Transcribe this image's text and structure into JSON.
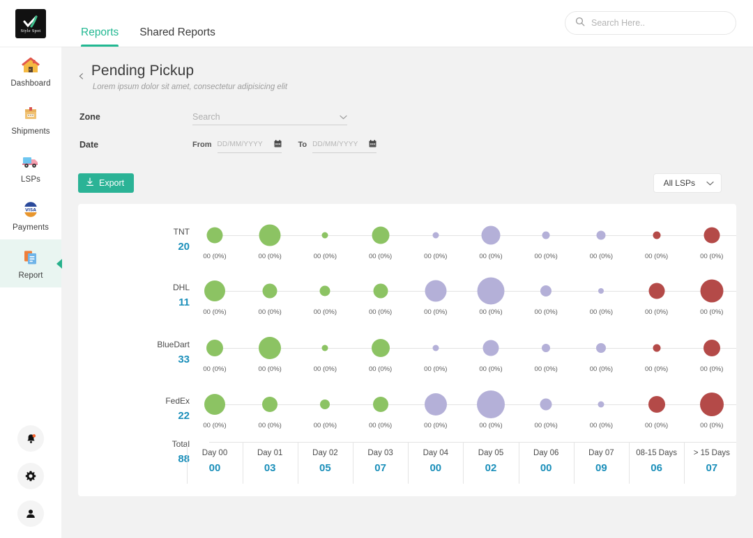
{
  "brand": {
    "name": "Style Spot",
    "logo_icon": "checkmark-logo-icon"
  },
  "sidebar": {
    "items": [
      {
        "label": "Dashboard",
        "icon": "house-icon",
        "active": false
      },
      {
        "label": "Shipments",
        "icon": "package-box-icon",
        "active": false
      },
      {
        "label": "LSPs",
        "icon": "delivery-truck-icon",
        "active": false
      },
      {
        "label": "Payments",
        "icon": "visa-card-icon",
        "active": false
      },
      {
        "label": "Report",
        "icon": "report-document-icon",
        "active": true
      }
    ],
    "bottom_icons": [
      {
        "name": "notification-bell-icon",
        "badge": true
      },
      {
        "name": "settings-gear-icon",
        "badge": false
      },
      {
        "name": "user-account-icon",
        "badge": false
      }
    ]
  },
  "topbar": {
    "tabs": [
      {
        "label": "Reports",
        "active": true
      },
      {
        "label": "Shared Reports",
        "active": false
      }
    ],
    "search": {
      "placeholder": "Search Here..",
      "value": "",
      "icon": "search-icon"
    }
  },
  "page": {
    "back_icon": "chevron-left-icon",
    "title": "Pending Pickup",
    "subtitle": "Lorem ipsum dolor sit amet, consectetur adipisicing elit"
  },
  "filters": {
    "zone": {
      "label": "Zone",
      "placeholder": "Search",
      "value": "",
      "chevron_icon": "chevron-down-icon"
    },
    "date": {
      "label": "Date",
      "from_label": "From",
      "to_label": "To",
      "from_placeholder": "DD/MM/YYYY",
      "to_placeholder": "DD/MM/YYYY",
      "from_value": "",
      "to_value": "",
      "calendar_icon": "calendar-icon"
    }
  },
  "actions": {
    "export_label": "Export",
    "export_icon": "download-icon",
    "export_color": "#2bb396",
    "lsp_filter_label": "All LSPs",
    "lsp_chevron_icon": "chevron-down-icon"
  },
  "chart_data": {
    "type": "bubble",
    "title": "Pending Pickup",
    "xlabel": "",
    "ylabel": "",
    "grid": true,
    "legend": false,
    "bubble_label_template": "00 (0%)",
    "colors": {
      "green": "#8cc363",
      "purple": "#b4b0d8",
      "red": "#b44a48",
      "value_text": "#1b8fba"
    },
    "categories": [
      {
        "label": "Day 00",
        "total": "00"
      },
      {
        "label": "Day 01",
        "total": "03"
      },
      {
        "label": "Day 02",
        "total": "05"
      },
      {
        "label": "Day 03",
        "total": "07"
      },
      {
        "label": "Day 04",
        "total": "00"
      },
      {
        "label": "Day 05",
        "total": "02"
      },
      {
        "label": "Day 06",
        "total": "00"
      },
      {
        "label": "Day 07",
        "total": "09"
      },
      {
        "label": "08-15 Days",
        "total": "06"
      },
      {
        "label": "> 15 Days",
        "total": "07"
      }
    ],
    "total_row": {
      "label": "Total",
      "value": "88"
    },
    "series": [
      {
        "name": "TNT",
        "value": "20",
        "labels": [
          "00 (0%)",
          "00 (0%)",
          "00 (0%)",
          "00 (0%)",
          "00 (0%)",
          "00 (0%)",
          "00 (0%)",
          "00 (0%)",
          "00 (0%)",
          "00 (0%)"
        ],
        "sizes": [
          23,
          31,
          9,
          25,
          9,
          27,
          11,
          13,
          11,
          23
        ],
        "colors": [
          "green",
          "green",
          "green",
          "green",
          "purple",
          "purple",
          "purple",
          "purple",
          "red",
          "red"
        ]
      },
      {
        "name": "DHL",
        "value": "11",
        "labels": [
          "00 (0%)",
          "00 (0%)",
          "00 (0%)",
          "00 (0%)",
          "00 (0%)",
          "00 (0%)",
          "00 (0%)",
          "00 (0%)",
          "00 (0%)",
          "00 (0%)"
        ],
        "sizes": [
          30,
          21,
          15,
          21,
          31,
          39,
          16,
          8,
          23,
          33
        ],
        "colors": [
          "green",
          "green",
          "green",
          "green",
          "purple",
          "purple",
          "purple",
          "purple",
          "red",
          "red"
        ]
      },
      {
        "name": "BlueDart",
        "value": "33",
        "labels": [
          "00 (0%)",
          "00 (0%)",
          "00 (0%)",
          "00 (0%)",
          "00 (0%)",
          "00 (0%)",
          "00 (0%)",
          "00 (0%)",
          "00 (0%)",
          "00 (0%)"
        ],
        "sizes": [
          24,
          32,
          9,
          26,
          9,
          23,
          12,
          14,
          11,
          24
        ],
        "colors": [
          "green",
          "green",
          "green",
          "green",
          "purple",
          "purple",
          "purple",
          "purple",
          "red",
          "red"
        ]
      },
      {
        "name": "FedEx",
        "value": "22",
        "labels": [
          "00 (0%)",
          "00 (0%)",
          "00 (0%)",
          "00 (0%)",
          "00 (0%)",
          "00 (0%)",
          "00 (0%)",
          "00 (0%)",
          "00 (0%)",
          "00 (0%)"
        ],
        "sizes": [
          30,
          22,
          14,
          22,
          32,
          40,
          17,
          9,
          24,
          34
        ],
        "colors": [
          "green",
          "green",
          "green",
          "green",
          "purple",
          "purple",
          "purple",
          "purple",
          "red",
          "red"
        ]
      }
    ]
  }
}
